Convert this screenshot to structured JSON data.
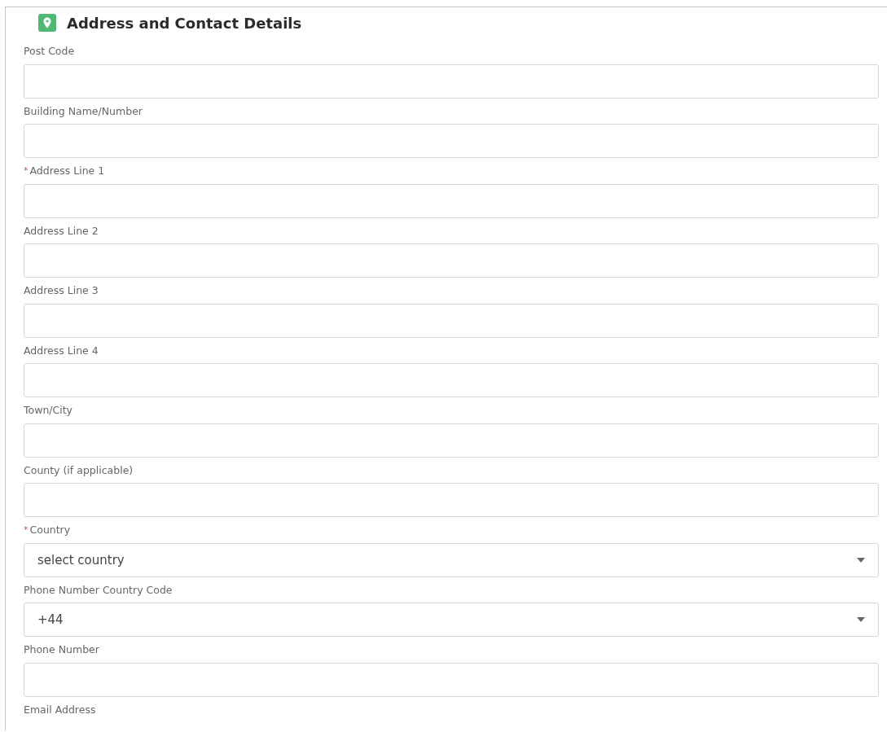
{
  "section": {
    "title": "Address and Contact Details"
  },
  "fields": [
    {
      "kind": "text",
      "label": "Post Code",
      "required": false
    },
    {
      "kind": "text",
      "label": "Building Name/Number",
      "required": false
    },
    {
      "kind": "text",
      "label": "Address Line 1",
      "required": true,
      "required_mark": "*"
    },
    {
      "kind": "text",
      "label": "Address Line 2",
      "required": false
    },
    {
      "kind": "text",
      "label": "Address Line 3",
      "required": false
    },
    {
      "kind": "text",
      "label": "Address Line 4",
      "required": false
    },
    {
      "kind": "text",
      "label": "Town/City",
      "required": false
    },
    {
      "kind": "text",
      "label": "County (if applicable)",
      "required": false
    },
    {
      "kind": "select",
      "label": "Country",
      "required": true,
      "required_mark": "*",
      "value": "select country"
    },
    {
      "kind": "select",
      "label": "Phone Number Country Code",
      "required": false,
      "value": "+44"
    },
    {
      "kind": "text",
      "label": "Phone Number",
      "required": false
    },
    {
      "kind": "label",
      "label": "Email Address",
      "required": false
    }
  ]
}
